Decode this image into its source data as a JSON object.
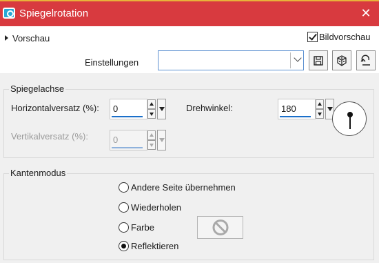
{
  "window": {
    "title": "Spiegelrotation",
    "close_glyph": "✕"
  },
  "preview": {
    "label": "Vorschau",
    "bildvorschau_label": "Bildvorschau",
    "bildvorschau_checked": true
  },
  "settings": {
    "label": "Einstellungen",
    "value": "",
    "buttons": [
      "save-icon",
      "dice-icon",
      "reset-icon"
    ]
  },
  "mirror_axis": {
    "title": "Spiegelachse",
    "horizontal_label": "Horizontalversatz (%):",
    "horizontal_value": "0",
    "vertical_label": "Vertikalversatz (%):",
    "vertical_value": "0",
    "angle_label": "Drehwinkel:",
    "angle_value": "180"
  },
  "edge_mode": {
    "title": "Kantenmodus",
    "options": [
      "Andere Seite übernehmen",
      "Wiederholen",
      "Farbe",
      "Reflektieren"
    ],
    "selected": "Reflektieren",
    "color_swatch": "no-color-icon"
  },
  "colors": {
    "titlebar": "#d83a3f",
    "accent": "#1a6fc9"
  }
}
